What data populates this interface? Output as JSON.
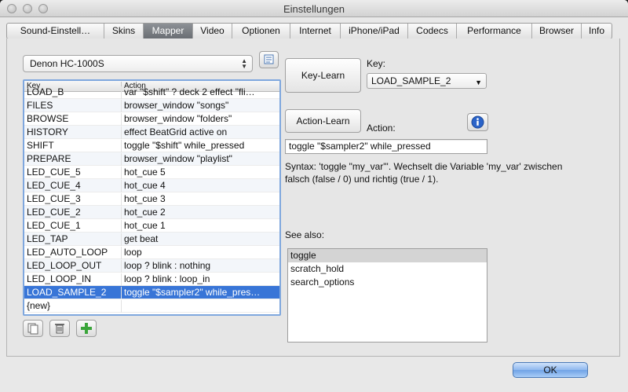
{
  "window": {
    "title": "Einstellungen"
  },
  "tabs": [
    {
      "label": "Sound-Einstell…",
      "w": 124
    },
    {
      "label": "Skins",
      "w": 50
    },
    {
      "label": "Mapper",
      "w": 63,
      "active": true
    },
    {
      "label": "Video",
      "w": 50
    },
    {
      "label": "Optionen",
      "w": 74
    },
    {
      "label": "Internet",
      "w": 64
    },
    {
      "label": "iPhone/iPad",
      "w": 86
    },
    {
      "label": "Codecs",
      "w": 62
    },
    {
      "label": "Performance",
      "w": 96
    },
    {
      "label": "Browser",
      "w": 63
    },
    {
      "label": "Info",
      "w": 38
    }
  ],
  "device": {
    "selected": "Denon HC-1000S"
  },
  "table": {
    "headers": {
      "key": "Key",
      "action": "Action"
    },
    "rows": [
      {
        "key": "LOAD_B",
        "action": "var \"$shift\" ? deck 2 effect \"fli…",
        "cut": true
      },
      {
        "key": "FILES",
        "action": "browser_window \"songs\""
      },
      {
        "key": "BROWSE",
        "action": "browser_window \"folders\""
      },
      {
        "key": "HISTORY",
        "action": "effect BeatGrid active on"
      },
      {
        "key": "SHIFT",
        "action": "toggle \"$shift\" while_pressed"
      },
      {
        "key": "PREPARE",
        "action": "browser_window \"playlist\""
      },
      {
        "key": "LED_CUE_5",
        "action": "hot_cue 5"
      },
      {
        "key": "LED_CUE_4",
        "action": "hot_cue 4"
      },
      {
        "key": "LED_CUE_3",
        "action": "hot_cue 3"
      },
      {
        "key": "LED_CUE_2",
        "action": "hot_cue 2"
      },
      {
        "key": "LED_CUE_1",
        "action": "hot_cue 1"
      },
      {
        "key": "LED_TAP",
        "action": "get beat"
      },
      {
        "key": "LED_AUTO_LOOP",
        "action": "loop"
      },
      {
        "key": "LED_LOOP_OUT",
        "action": "loop ? blink : nothing"
      },
      {
        "key": "LED_LOOP_IN",
        "action": "loop ? blink : loop_in"
      },
      {
        "key": "LOAD_SAMPLE_2",
        "action": "toggle \"$sampler2\" while_pres…",
        "selected": true
      },
      {
        "key": "{new}",
        "action": ""
      }
    ]
  },
  "key_learn": {
    "button": "Key-Learn",
    "label": "Key:",
    "value": "LOAD_SAMPLE_2"
  },
  "action_learn": {
    "button": "Action-Learn",
    "label": "Action:",
    "value": "toggle \"$sampler2\" while_pressed"
  },
  "syntax": {
    "line1": "Syntax: 'toggle \"my_var\"'. Wechselt die Variable 'my_var' zwischen",
    "line2": "falsch (false / 0) und richtig (true / 1)."
  },
  "see_also": {
    "label": "See also:",
    "items": [
      {
        "label": "toggle",
        "selected": true
      },
      {
        "label": "scratch_hold"
      },
      {
        "label": "search_options"
      }
    ]
  },
  "footer": {
    "ok": "OK"
  },
  "colors": {
    "selection": "#3875d7",
    "info_button": "#2a63c9",
    "add_icon": "#3aa53a"
  }
}
